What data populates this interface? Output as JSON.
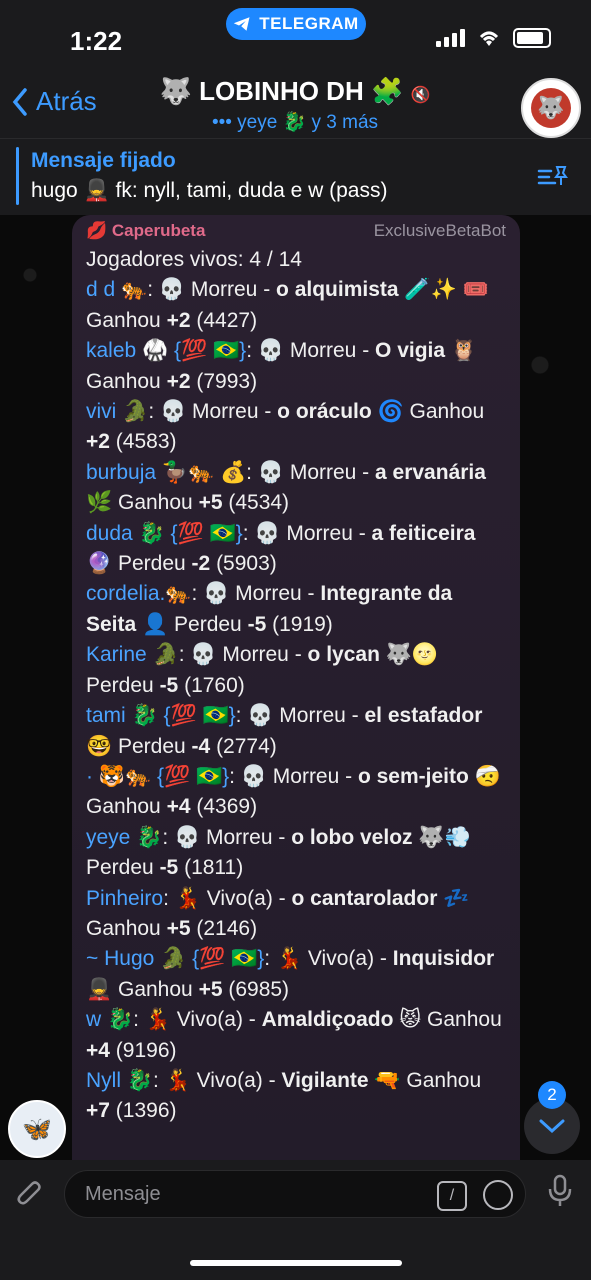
{
  "status": {
    "time": "1:22",
    "app_pill": "TELEGRAM"
  },
  "nav": {
    "back_label": "Atrás",
    "title": "🐺 LOBINHO DH 🧩",
    "subtitle": "••• yeye 🐉 y 3 más"
  },
  "pinned": {
    "title": "Mensaje fijado",
    "text": "hugo 💂 fk: nyll, tami, duda e w (pass)"
  },
  "message": {
    "sender": "💋 Caperubeta",
    "via": "ExclusiveBetaBot",
    "header_line": "Jogadores vivos: 4 / 14",
    "players": [
      {
        "name": "d d 🐅",
        "status": ": 💀 Morreu - ",
        "role": "o alquimista 🧪✨",
        "pre": "",
        "result": " 🎟️ Ganhou ",
        "score": "+2",
        "total": " (4427)"
      },
      {
        "name": "kaleb 🥋 {💯 🇧🇷}",
        "status": ": 💀 Morreu - ",
        "role": "O vigia 🦉",
        "result": " Ganhou ",
        "score": "+2",
        "total": " (7993)"
      },
      {
        "name": "vivi 🐊",
        "status": ": 💀 Morreu - ",
        "role": "o oráculo 🌀",
        "result": " Ganhou ",
        "score": "+2",
        "total": " (4583)"
      },
      {
        "name": "burbuja 🦆🐅 💰",
        "status": ": 💀 Morreu - ",
        "role": "a ervanária 🌿",
        "result": " Ganhou ",
        "score": "+5",
        "total": " (4534)"
      },
      {
        "name": "duda 🐉 {💯 🇧🇷}",
        "status": ": 💀 Morreu - ",
        "role": "a feiticeira 🔮",
        "result": " Perdeu ",
        "score": "-2",
        "total": " (5903)"
      },
      {
        "name": "cordelia.🐅",
        "status": ": 💀 Morreu - ",
        "role": "Integrante da Seita 👤",
        "result": " Perdeu ",
        "score": "-5",
        "total": " (1919)"
      },
      {
        "name": "Karine 🐊",
        "status": ": 💀 Morreu - ",
        "role": "o lycan 🐺🌝",
        "result": " Perdeu ",
        "score": "-5",
        "total": " (1760)"
      },
      {
        "name": "tami 🐉 {💯 🇧🇷}",
        "status": ": 💀 Morreu - ",
        "role": "el estafador 🤓",
        "result": " Perdeu ",
        "score": "-4",
        "total": " (2774)"
      },
      {
        "name": "· 🐯🐅 {💯 🇧🇷}",
        "status": ": 💀 Morreu - ",
        "role": "o sem-jeito 🤕",
        "result": " Ganhou ",
        "score": "+4",
        "total": " (4369)"
      },
      {
        "name": "yeye 🐉",
        "status": ": 💀 Morreu - ",
        "role": "o lobo veloz 🐺💨",
        "result": " Perdeu ",
        "score": "-5",
        "total": " (1811)"
      },
      {
        "name": "Pinheiro",
        "status": ": 💃 Vivo(a) - ",
        "role": "o cantarolador 💤",
        "result": " Ganhou ",
        "score": "+5",
        "total": " (2146)"
      },
      {
        "name": "~ Hugo 🐊 {💯 🇧🇷}",
        "status": ": 💃 Vivo(a) - ",
        "role": "Inquisidor 💂",
        "result": " Ganhou ",
        "score": "+5",
        "total": " (6985)"
      },
      {
        "name": "w 🐉",
        "status": ": 💃 Vivo(a) - ",
        "role": "Amaldiçoado 😾",
        "result": " Ganhou ",
        "score": "+4",
        "total": " (9196)"
      },
      {
        "name": "Nyll 🐉",
        "status": ": 💃 Vivo(a) - ",
        "role": "Vigilante 🔫",
        "result": " Ganhou ",
        "score": "+7",
        "total": " (1396)"
      }
    ]
  },
  "scroll": {
    "unread": "2"
  },
  "composer": {
    "placeholder": "Mensaje"
  }
}
